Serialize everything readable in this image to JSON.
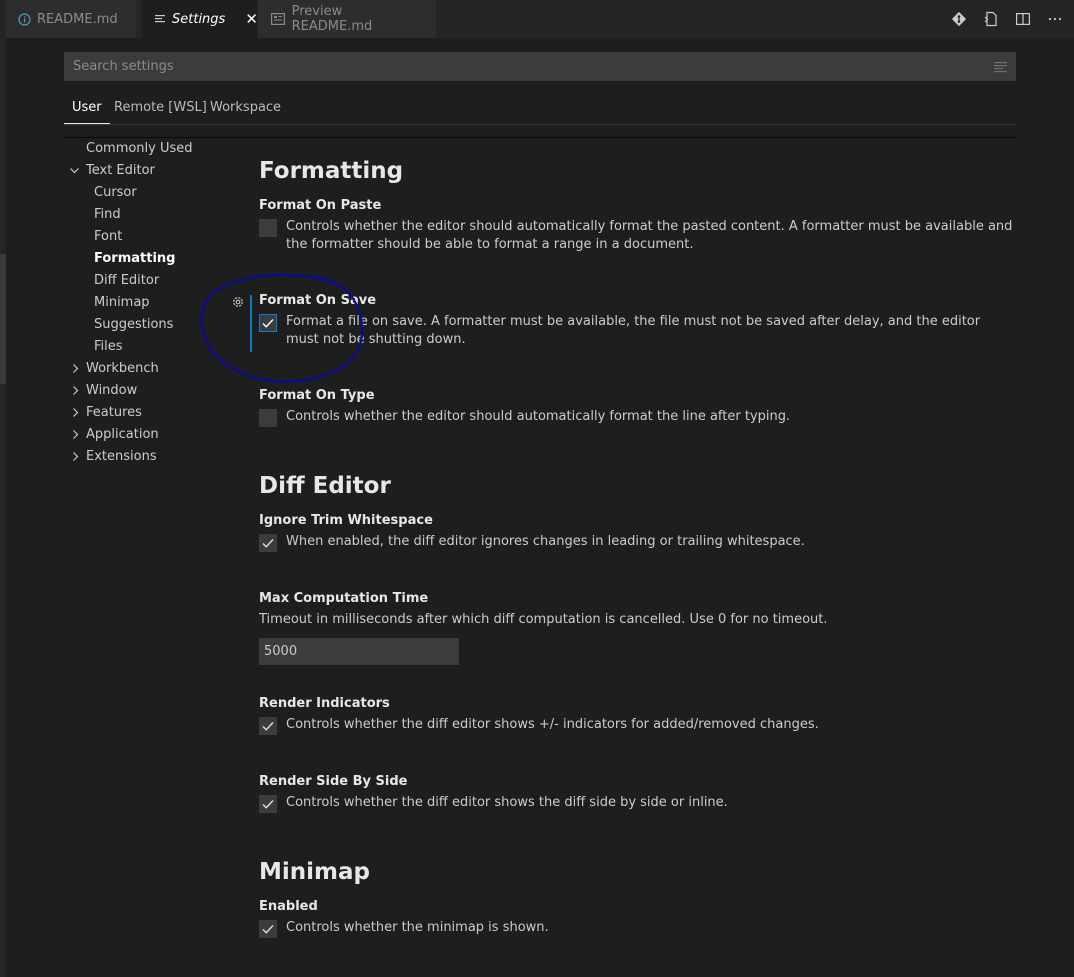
{
  "tabs": [
    {
      "label": "README.md",
      "icon": "info-icon",
      "dirty": true
    },
    {
      "label": "Settings",
      "icon": "settings-file-icon",
      "active": true
    },
    {
      "label": "Preview README.md",
      "icon": "preview-icon"
    }
  ],
  "search": {
    "placeholder": "Search settings"
  },
  "scope_tabs": [
    "User",
    "Remote [WSL]",
    "Workspace"
  ],
  "toc": {
    "commonly_used": "Commonly Used",
    "text_editor": "Text Editor",
    "text_editor_children": [
      "Cursor",
      "Find",
      "Font",
      "Formatting",
      "Diff Editor",
      "Minimap",
      "Suggestions",
      "Files"
    ],
    "collapsed": [
      "Workbench",
      "Window",
      "Features",
      "Application",
      "Extensions"
    ]
  },
  "sections": {
    "formatting": {
      "title": "Formatting",
      "format_on_paste": {
        "title": "Format On Paste",
        "desc": "Controls whether the editor should automatically format the pasted content. A formatter must be available and the formatter should be able to format a range in a document.",
        "checked": false
      },
      "format_on_save": {
        "title": "Format On Save",
        "desc": "Format a file on save. A formatter must be available, the file must not be saved after delay, and the editor must not be shutting down.",
        "checked": true
      },
      "format_on_type": {
        "title": "Format On Type",
        "desc": "Controls whether the editor should automatically format the line after typing.",
        "checked": false
      }
    },
    "diff_editor": {
      "title": "Diff Editor",
      "ignore_trim": {
        "title": "Ignore Trim Whitespace",
        "desc": "When enabled, the diff editor ignores changes in leading or trailing whitespace.",
        "checked": true
      },
      "max_time": {
        "title": "Max Computation Time",
        "desc": "Timeout in milliseconds after which diff computation is cancelled. Use 0 for no timeout.",
        "value": "5000"
      },
      "render_indicators": {
        "title": "Render Indicators",
        "desc": "Controls whether the diff editor shows +/- indicators for added/removed changes.",
        "checked": true
      },
      "side_by_side": {
        "title": "Render Side By Side",
        "desc": "Controls whether the diff editor shows the diff side by side or inline.",
        "checked": true
      }
    },
    "minimap": {
      "title": "Minimap",
      "enabled": {
        "title": "Enabled",
        "desc": "Controls whether the minimap is shown.",
        "checked": true
      }
    }
  },
  "colors": {
    "accent": "#007fd4",
    "annotation": "#0a0a9a",
    "background": "#1e1e1e"
  }
}
